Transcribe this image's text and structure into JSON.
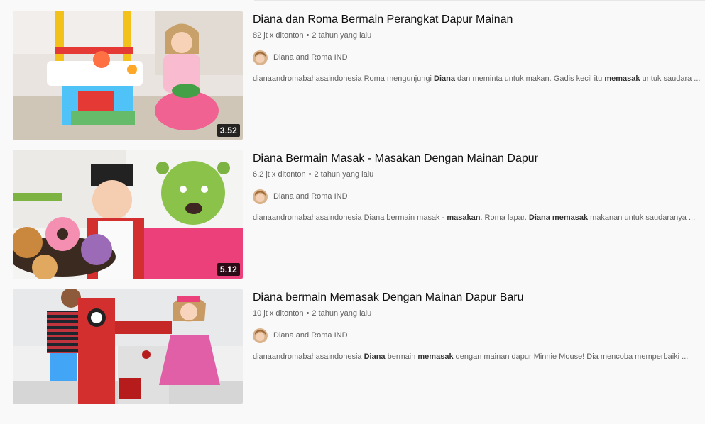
{
  "videos": [
    {
      "title": "Diana dan Roma Bermain Perangkat Dapur Mainan",
      "views": "82 jt x ditonton",
      "age": "2 tahun yang lalu",
      "channel": "Diana and Roma IND",
      "duration": "3.52",
      "desc_parts": [
        {
          "t": "dianaandromabahasaindonesia Roma mengunjungi ",
          "b": false
        },
        {
          "t": "Diana",
          "b": true
        },
        {
          "t": " dan meminta untuk makan. Gadis kecil itu ",
          "b": false
        },
        {
          "t": "memasak",
          "b": true
        },
        {
          "t": " untuk saudara ...",
          "b": false
        }
      ]
    },
    {
      "title": "Diana Bermain Masak - Masakan Dengan Mainan Dapur",
      "views": "6,2 jt x ditonton",
      "age": "2 tahun yang lalu",
      "channel": "Diana and Roma IND",
      "duration": "5.12",
      "desc_parts": [
        {
          "t": "dianaandromabahasaindonesia Diana bermain masak - ",
          "b": false
        },
        {
          "t": "masakan",
          "b": true
        },
        {
          "t": ". Roma lapar. ",
          "b": false
        },
        {
          "t": "Diana memasak",
          "b": true
        },
        {
          "t": " makanan untuk saudaranya ...",
          "b": false
        }
      ]
    },
    {
      "title": "Diana bermain Memasak Dengan Mainan Dapur Baru",
      "views": "10 jt x ditonton",
      "age": "2 tahun yang lalu",
      "channel": "Diana and Roma IND",
      "duration": "",
      "desc_parts": [
        {
          "t": "dianaandromabahasaindonesia ",
          "b": false
        },
        {
          "t": "Diana",
          "b": true
        },
        {
          "t": " bermain ",
          "b": false
        },
        {
          "t": "memasak",
          "b": true
        },
        {
          "t": " dengan mainan dapur Minnie Mouse! Dia mencoba memperbaiki ...",
          "b": false
        }
      ]
    }
  ],
  "meta_separator": "•",
  "colors": {
    "title": "#0f0f0f",
    "meta": "#606060",
    "duration_bg": "#000000"
  }
}
